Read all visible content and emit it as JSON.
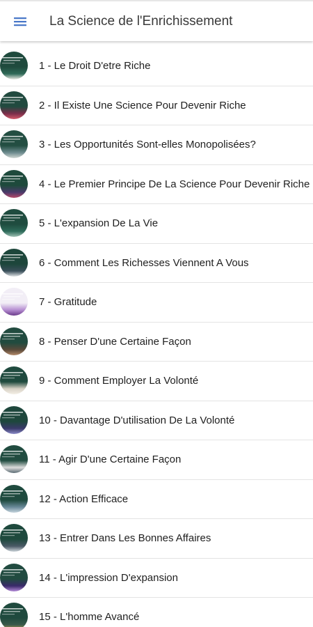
{
  "appbar": {
    "title": "La Science de l'Enrichissement",
    "menu_icon": "hamburger-menu-icon",
    "accent": "#4a78c8"
  },
  "chapters": [
    {
      "label": "1 - Le Droit D'etre Riche",
      "thumb": [
        "#1f4a3d",
        "#2f6a58",
        "#e8e8e0"
      ]
    },
    {
      "label": "2 - Il Existe Une Science Pour Devenir Riche",
      "thumb": [
        "#214a3f",
        "#7a2e4a",
        "#d45a6a"
      ]
    },
    {
      "label": "3 - Les Opportunités Sont-elles Monopolisées?",
      "thumb": [
        "#234e42",
        "#6c8a8e",
        "#cfd6d2"
      ]
    },
    {
      "label": "4 - Le Premier Principe De La Science Pour Devenir Riche",
      "thumb": [
        "#1e4a3c",
        "#4a3a6a",
        "#b64a6a"
      ]
    },
    {
      "label": "5 - L'expansion De La Vie",
      "thumb": [
        "#1f4c3f",
        "#2e6b5a",
        "#9fc0b4"
      ]
    },
    {
      "label": "6 - Comment Les Richesses Viennent A Vous",
      "thumb": [
        "#1d463b",
        "#3a4f5a",
        "#e0e4e6"
      ]
    },
    {
      "label": "7 - Gratitude",
      "thumb": [
        "#f2eef6",
        "#b48cd0",
        "#6a3a8a"
      ]
    },
    {
      "label": "8 - Penser D'une Certaine Façon",
      "thumb": [
        "#214b3f",
        "#5a4a3a",
        "#b48a6a"
      ]
    },
    {
      "label": "9 - Comment Employer La Volonté",
      "thumb": [
        "#1f4a3e",
        "#d8d2c6",
        "#f4efe6"
      ]
    },
    {
      "label": "10 - Davantage D'utilisation De La Volonté",
      "thumb": [
        "#1e473c",
        "#3a3a6a",
        "#8a8ac8"
      ]
    },
    {
      "label": "11 - Agir D'une Certaine Façon",
      "thumb": [
        "#214c40",
        "#dcdcdc",
        "#5a6a72"
      ]
    },
    {
      "label": "12 - Action Efficace",
      "thumb": [
        "#1f4a3e",
        "#6a8a9a",
        "#c8d6de"
      ]
    },
    {
      "label": "13 - Entrer Dans Les Bonnes Affaires",
      "thumb": [
        "#1e493d",
        "#4a5a66",
        "#cfd7dc"
      ]
    },
    {
      "label": "14 - L'impression D'expansion",
      "thumb": [
        "#214b40",
        "#3a2a6a",
        "#b48ad8"
      ]
    },
    {
      "label": "15 - L'homme Avancé",
      "thumb": [
        "#1f4a3e",
        "#3a5a4a",
        "#d6b25a"
      ]
    }
  ]
}
